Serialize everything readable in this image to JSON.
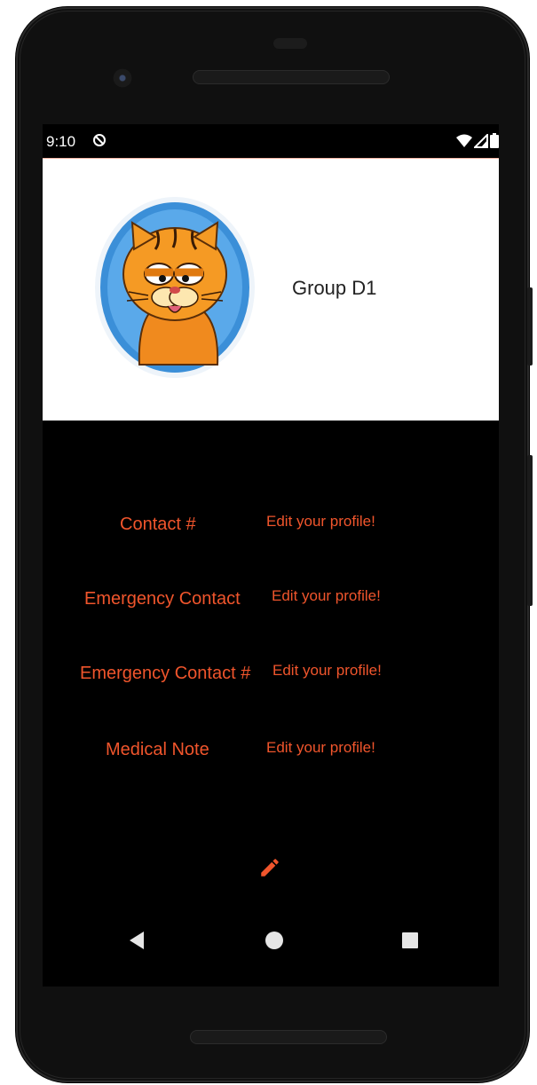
{
  "status_bar": {
    "time": "9:10",
    "icons": [
      "sync-off-icon",
      "wifi-icon",
      "cellular-signal-icon",
      "battery-icon"
    ]
  },
  "profile": {
    "group_name": "Group D1",
    "avatar": "garfield-avatar"
  },
  "fields": [
    {
      "label": "Contact #",
      "value": "Edit your profile!"
    },
    {
      "label": "Emergency Contact",
      "value": "Edit your profile!"
    },
    {
      "label": "Emergency Contact #",
      "value": "Edit your profile!"
    },
    {
      "label": "Medical Note",
      "value": "Edit your profile!"
    }
  ],
  "edit_button": {
    "icon": "pencil-icon"
  },
  "nav_bar": {
    "icons": [
      "back-icon",
      "home-icon",
      "recents-icon"
    ]
  },
  "colors": {
    "accent": "#f0552c",
    "screen_bg": "#000000",
    "header_bg": "#ffffff"
  }
}
